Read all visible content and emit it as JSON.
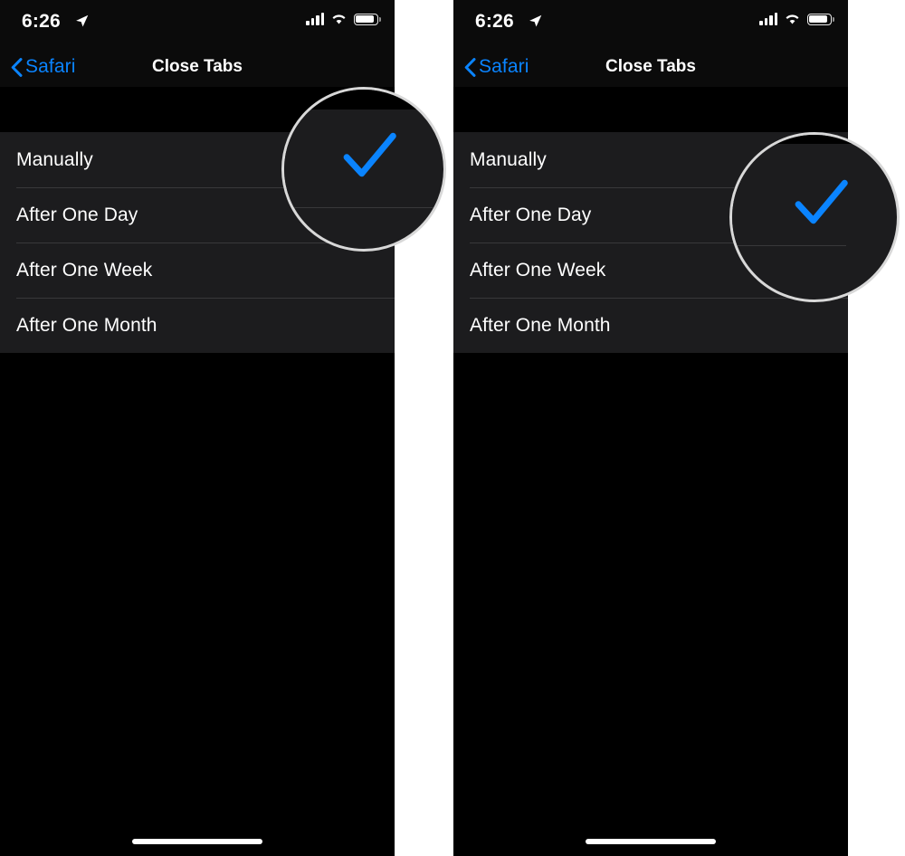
{
  "meta": {
    "accent_blue": "#0a84ff",
    "list_bg": "#1c1c1e",
    "separator": "#38383a",
    "page_bg": "#000000",
    "callout_ring": "#d8d8d8"
  },
  "panels": [
    {
      "id": "left-panel",
      "status_bar": {
        "time": "6:26",
        "location_icon": "location-arrow-icon",
        "cellular_icon": "cellular-bars-icon",
        "wifi_icon": "wifi-icon",
        "battery_icon": "battery-icon",
        "battery_level_percent": 88
      },
      "nav_bar": {
        "back_label": "Safari",
        "back_icon": "chevron-left-icon",
        "title": "Close Tabs"
      },
      "options": [
        {
          "label": "Manually",
          "selected": true
        },
        {
          "label": "After One Day",
          "selected": false
        },
        {
          "label": "After One Week",
          "selected": false
        },
        {
          "label": "After One Month",
          "selected": false
        }
      ],
      "callout": {
        "target_option": "Manually",
        "magnified_icon": "checkmark-icon"
      },
      "home_indicator": "home-indicator"
    },
    {
      "id": "right-panel",
      "status_bar": {
        "time": "6:26",
        "location_icon": "location-arrow-icon",
        "cellular_icon": "cellular-bars-icon",
        "wifi_icon": "wifi-icon",
        "battery_icon": "battery-icon",
        "battery_level_percent": 88
      },
      "nav_bar": {
        "back_label": "Safari",
        "back_icon": "chevron-left-icon",
        "title": "Close Tabs"
      },
      "options": [
        {
          "label": "Manually",
          "selected": false
        },
        {
          "label": "After One Day",
          "selected": true
        },
        {
          "label": "After One Week",
          "selected": false
        },
        {
          "label": "After One Month",
          "selected": false
        }
      ],
      "callout": {
        "target_option": "After One Day",
        "magnified_icon": "checkmark-icon"
      },
      "home_indicator": "home-indicator"
    }
  ]
}
